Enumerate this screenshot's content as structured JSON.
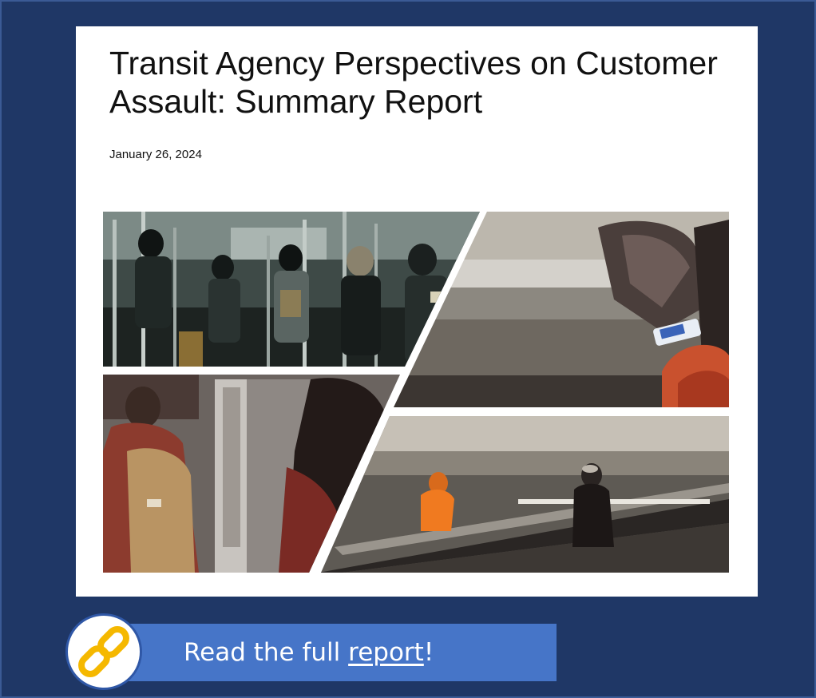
{
  "report": {
    "title": "Transit Agency Perspectives on Customer Assault: Summary Report",
    "date": "January 26, 2024",
    "cover_image": "transit-collage-illustration"
  },
  "cta": {
    "text_before": "Read the full ",
    "link_text": "report",
    "text_after": "!",
    "icon": "chain-link-icon"
  },
  "colors": {
    "background": "#1f3766",
    "card": "#ffffff",
    "cta_bar": "#4675c8",
    "link_icon": "#f5b800"
  }
}
